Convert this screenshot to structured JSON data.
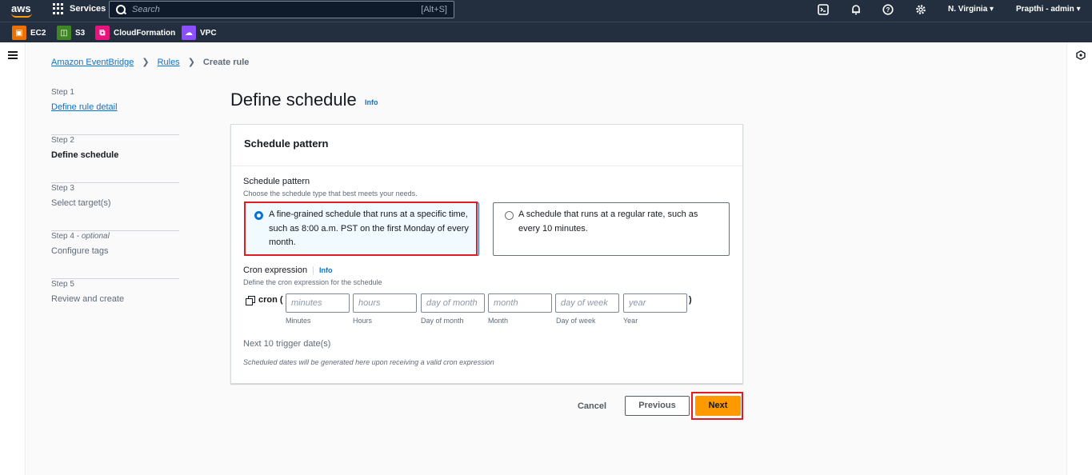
{
  "topnav": {
    "logo": "aws",
    "services_label": "Services",
    "search_placeholder": "Search",
    "search_shortcut": "[Alt+S]",
    "icons": [
      "cloudshell-icon",
      "notifications-icon",
      "help-icon",
      "settings-icon"
    ],
    "region": "N. Virginia",
    "account": "Prapthi - admin"
  },
  "favorites": [
    {
      "label": "EC2",
      "color": "#ed7100"
    },
    {
      "label": "S3",
      "color": "#3f8624"
    },
    {
      "label": "CloudFormation",
      "color": "#e7157b"
    },
    {
      "label": "VPC",
      "color": "#8c4fff"
    }
  ],
  "breadcrumb": {
    "items": [
      "Amazon EventBridge",
      "Rules"
    ],
    "current": "Create rule"
  },
  "steps": [
    {
      "num": "Step 1",
      "label": "Define rule detail"
    },
    {
      "num": "Step 2",
      "label": "Define schedule"
    },
    {
      "num": "Step 3",
      "label": "Select target(s)"
    },
    {
      "num": "Step 4",
      "optional": "optional",
      "label": "Configure tags"
    },
    {
      "num": "Step 5",
      "label": "Review and create"
    }
  ],
  "page": {
    "title": "Define schedule",
    "info": "Info"
  },
  "panel": {
    "header": "Schedule pattern",
    "field_label": "Schedule pattern",
    "field_desc": "Choose the schedule type that best meets your needs.",
    "option1": "A fine-grained schedule that runs at a specific time, such as 8:00 a.m. PST on the first Monday of every month.",
    "option2": "A schedule that runs at a regular rate, such as every 10 minutes.",
    "cron_label": "Cron expression",
    "cron_info": "Info",
    "cron_desc": "Define the cron expression for the schedule",
    "cron_word": "cron (",
    "cron_close": ")",
    "cron_fields": [
      {
        "placeholder": "minutes",
        "sub": "Minutes"
      },
      {
        "placeholder": "hours",
        "sub": "Hours"
      },
      {
        "placeholder": "day of month",
        "sub": "Day of month"
      },
      {
        "placeholder": "month",
        "sub": "Month"
      },
      {
        "placeholder": "day of week",
        "sub": "Day of week"
      },
      {
        "placeholder": "year",
        "sub": "Year"
      }
    ],
    "next_dates_label": "Next 10 trigger date(s)",
    "next_dates_note": "Scheduled dates will be generated here upon receiving a valid cron expression"
  },
  "buttons": {
    "cancel": "Cancel",
    "previous": "Previous",
    "next": "Next"
  }
}
